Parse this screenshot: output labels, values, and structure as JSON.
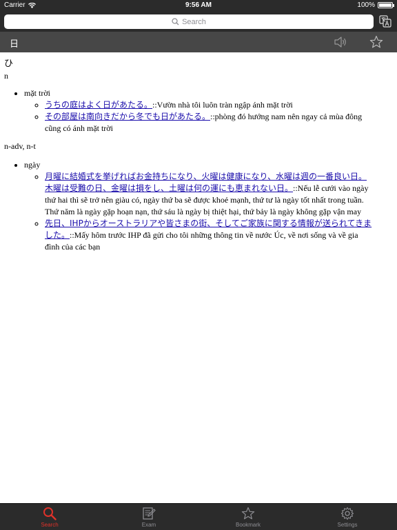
{
  "status_bar": {
    "carrier": "Carrier",
    "time": "9:56 AM",
    "battery_percent": "100%",
    "battery_level": 1.0
  },
  "search": {
    "placeholder": "Search"
  },
  "header": {
    "word": "日"
  },
  "entry": {
    "reading": "ひ",
    "senses": [
      {
        "pos": "n",
        "meaning": "mặt trời",
        "examples": [
          {
            "ja": "うちの庭はよく日があたる。",
            "vi": "::Vườn nhà tôi luôn tràn ngập ánh mặt trời"
          },
          {
            "ja": "その部屋は南向きだから冬でも日があたる。",
            "vi": "::phòng đó hướng nam nên ngay cả mùa đông cũng có ánh mặt trời"
          }
        ]
      },
      {
        "pos": "n-adv, n-t",
        "meaning": "ngày",
        "examples": [
          {
            "ja": "月曜に結婚式を挙げればお金持ちになり、火曜は健康になり、水曜は週の一番良い日。木曜は受難の日、金曜は損をし、土曜は何の運にも恵まれない日。",
            "vi": "::Nếu lễ cưới vào ngày thứ hai thì sẽ trở nên giàu có, ngày thứ ba sẽ được khoẻ mạnh, thứ tư là ngày tốt nhất trong tuần. Thứ năm là ngày gặp hoạn nạn, thứ sáu là ngày bị thiệt hại, thứ bảy là ngày không gặp vận may"
          },
          {
            "ja": "先日、IHPからオーストラリアや皆さまの街、そしてご家族に関する情報が送られてきました。",
            "vi": "::Mấy hôm trước IHP đã gửi cho tôi những thông tin về nước Úc, về nơi sống và về gia đình của các bạn"
          }
        ]
      }
    ]
  },
  "tabs": [
    {
      "label": "Search",
      "icon": "search-icon",
      "active": true
    },
    {
      "label": "Exam",
      "icon": "exam-icon",
      "active": false
    },
    {
      "label": "Bookmark",
      "icon": "bookmark-star-icon",
      "active": false
    },
    {
      "label": "Settings",
      "icon": "gear-icon",
      "active": false
    }
  ],
  "colors": {
    "accent": "#e0322a",
    "link": "#1a0dab",
    "bar": "#2b2b2b",
    "header": "#474747"
  }
}
